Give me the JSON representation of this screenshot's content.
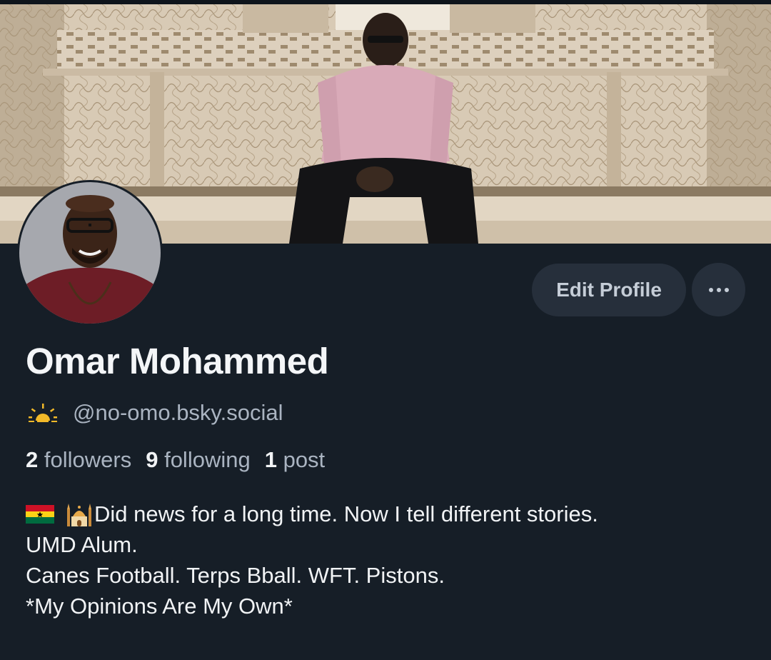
{
  "profile": {
    "display_name": "Omar Mohammed",
    "handle": "@no-omo.bsky.social",
    "handle_prefix_icon": "sunrise-icon",
    "followers_count": "2",
    "followers_label": "followers",
    "following_count": "9",
    "following_label": "following",
    "posts_count": "1",
    "posts_label": "post",
    "bio": {
      "line1_icons": [
        "ghana-flag-icon",
        "mosque-icon"
      ],
      "line1": "Did news for a long time. Now I tell different stories.",
      "line2": "UMD Alum.",
      "line3": "Canes Football. Terps Bball. WFT. Pistons.",
      "line4": "*My Opinions Are My Own*"
    }
  },
  "actions": {
    "edit_label": "Edit Profile",
    "more_icon": "more-horizontal-icon"
  },
  "colors": {
    "background": "#161e27",
    "button_bg": "#262f3b",
    "muted_text": "#aab4c1",
    "primary_text": "#f1f3f5"
  }
}
